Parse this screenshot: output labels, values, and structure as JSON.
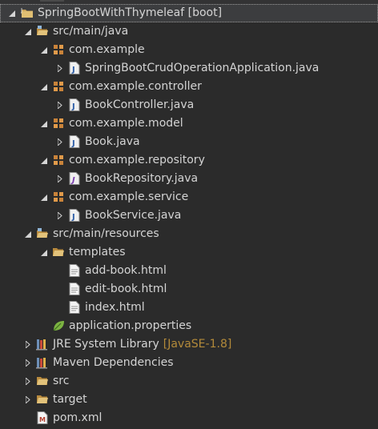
{
  "tree": {
    "project": {
      "label": "SpringBootWithThymeleaf",
      "decoration": "[boot]"
    },
    "src_main_java": {
      "label": "src/main/java"
    },
    "pkg_example": {
      "label": "com.example"
    },
    "file_app": {
      "label": "SpringBootCrudOperationApplication.java"
    },
    "pkg_controller": {
      "label": "com.example.controller"
    },
    "file_controller": {
      "label": "BookController.java"
    },
    "pkg_model": {
      "label": "com.example.model"
    },
    "file_model": {
      "label": "Book.java"
    },
    "pkg_repository": {
      "label": "com.example.repository"
    },
    "file_repository": {
      "label": "BookRepository.java"
    },
    "pkg_service": {
      "label": "com.example.service"
    },
    "file_service": {
      "label": "BookService.java"
    },
    "src_main_resources": {
      "label": "src/main/resources"
    },
    "templates": {
      "label": "templates"
    },
    "file_add_book": {
      "label": "add-book.html"
    },
    "file_edit_book": {
      "label": "edit-book.html"
    },
    "file_index": {
      "label": "index.html"
    },
    "app_properties": {
      "label": "application.properties"
    },
    "jre_library": {
      "label": "JRE System Library",
      "decoration": "[JavaSE-1.8]"
    },
    "maven_deps": {
      "label": "Maven Dependencies"
    },
    "src": {
      "label": "src"
    },
    "target": {
      "label": "target"
    },
    "pom": {
      "label": "pom.xml"
    }
  },
  "colors": {
    "background": "#2b2b2b",
    "text": "#d4d4d4",
    "decoration": "#b38a3a",
    "selection": "#3c3d3f"
  }
}
